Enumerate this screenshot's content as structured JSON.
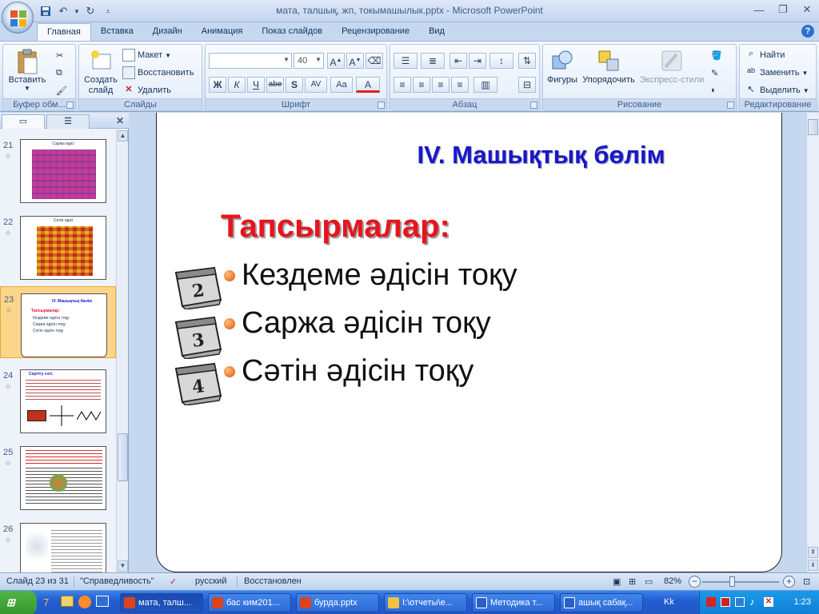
{
  "window": {
    "title": "мата, талшық, жп, токымашылык.pptx - Microsoft PowerPoint",
    "controls": [
      "minimize",
      "restore",
      "close"
    ]
  },
  "ribbon": {
    "tabs": [
      "Главная",
      "Вставка",
      "Дизайн",
      "Анимация",
      "Показ слайдов",
      "Рецензирование",
      "Вид"
    ],
    "active_tab": "Главная",
    "groups": {
      "clipboard": {
        "label": "Буфер обм...",
        "paste": "Вставить"
      },
      "slides": {
        "label": "Слайды",
        "new_slide": "Создать слайд",
        "layout": "Макет",
        "reset": "Восстановить",
        "delete": "Удалить"
      },
      "font": {
        "label": "Шрифт",
        "font_name": "",
        "font_size": "40",
        "bold": "Ж",
        "italic": "К",
        "underline": "Ч",
        "strike": "abe",
        "shadow": "S",
        "spacing": "AV",
        "case": "Aa",
        "color": "A"
      },
      "paragraph": {
        "label": "Абзац"
      },
      "drawing": {
        "label": "Рисование",
        "shapes": "Фигуры",
        "arrange": "Упорядочить",
        "quick_styles": "Экспресс-стили"
      },
      "editing": {
        "label": "Редактирование",
        "find": "Найти",
        "replace": "Заменить",
        "select": "Выделить"
      }
    }
  },
  "thumbnails": [
    {
      "num": "21",
      "title": "Саржа әдісі"
    },
    {
      "num": "22",
      "title": "Сәтін әдісі"
    },
    {
      "num": "23",
      "title": "IV. Машықтық бөлім",
      "selected": true
    },
    {
      "num": "24",
      "title": "Сергіту сәті."
    },
    {
      "num": "25",
      "title": ""
    },
    {
      "num": "26",
      "title": ""
    }
  ],
  "slide": {
    "title": "IV. Машықтық бөлім",
    "subtitle": "Тапсырмалар:",
    "items": [
      {
        "text": "Кездеме әдісін тоқу",
        "icon_num": "2"
      },
      {
        "text": "Саржа әдісін тоқу",
        "icon_num": "3"
      },
      {
        "text": "Сәтін әдісін тоқу",
        "icon_num": "4"
      }
    ],
    "colors": {
      "title": "#1818c8",
      "subtitle": "#e8141c"
    }
  },
  "statusbar": {
    "slide_info": "Слайд 23 из 31",
    "theme": "\"Справедливость\"",
    "language": "русский",
    "status": "Восстановлен",
    "zoom": "82%"
  },
  "taskbar": {
    "start": "Пуск",
    "items": [
      {
        "label": "мата, талш...",
        "active": true,
        "color": "#d9441e"
      },
      {
        "label": "бас ким201...",
        "color": "#d9441e"
      },
      {
        "label": "бурда.pptx",
        "color": "#d9441e"
      },
      {
        "label": "I:\\отчеты\\е...",
        "color": "#f0c040"
      },
      {
        "label": "Методика т...",
        "color": "#2b5fc7"
      },
      {
        "label": "ашық сабақ...",
        "color": "#2b5fc7"
      }
    ],
    "lang": "Kk",
    "clock": "1:23"
  }
}
